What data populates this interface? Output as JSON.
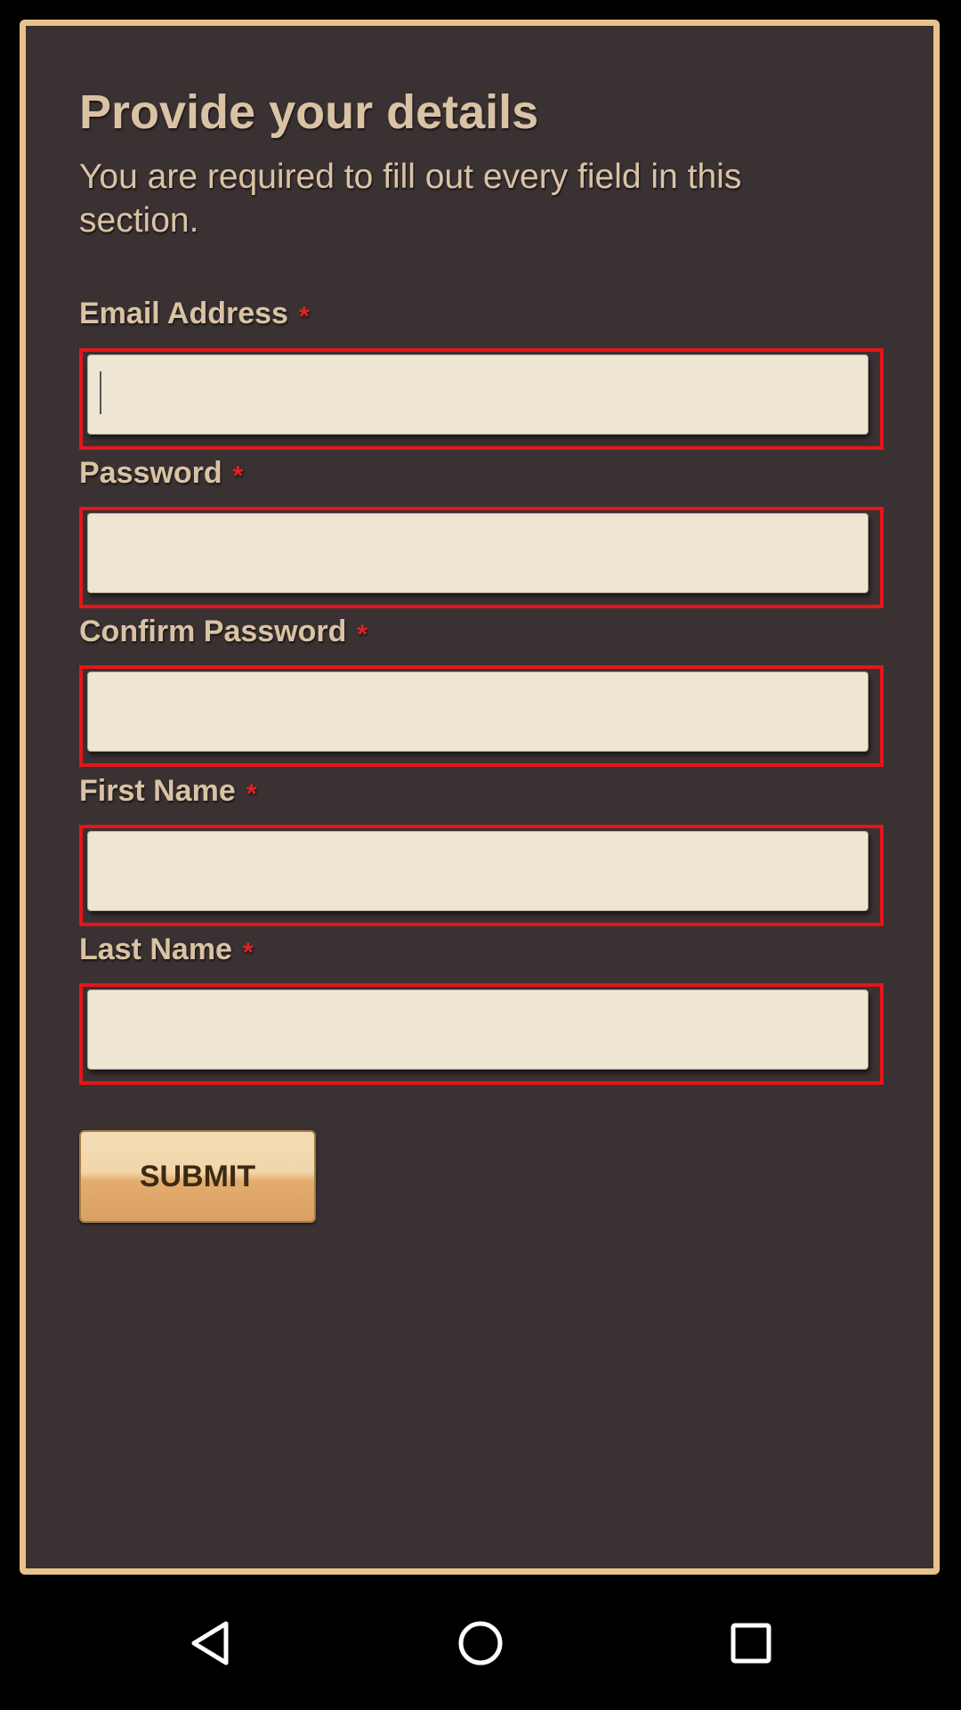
{
  "form": {
    "title": "Provide your details",
    "subtitle": "You are required to fill out every field in this section.",
    "required_marker": "*",
    "fields": [
      {
        "label": "Email Address",
        "value": "",
        "placeholder": ""
      },
      {
        "label": "Password",
        "value": "",
        "placeholder": ""
      },
      {
        "label": "Confirm Password",
        "value": "",
        "placeholder": ""
      },
      {
        "label": "First Name",
        "value": "",
        "placeholder": ""
      },
      {
        "label": "Last Name",
        "value": "",
        "placeholder": ""
      }
    ],
    "submit_label": "SUBMIT"
  },
  "theme": {
    "panel_background": "#3a3133",
    "panel_border": "#e8c38a",
    "text_color": "#d9c3a4",
    "error_border": "#e4161a",
    "required_color": "#e2241f",
    "input_background": "#efe5d3",
    "button_gradient_top": "#f3dcb5",
    "button_gradient_bottom": "#d9a064"
  },
  "navbar": {
    "icons": [
      "back-icon",
      "home-icon",
      "recents-icon"
    ]
  }
}
